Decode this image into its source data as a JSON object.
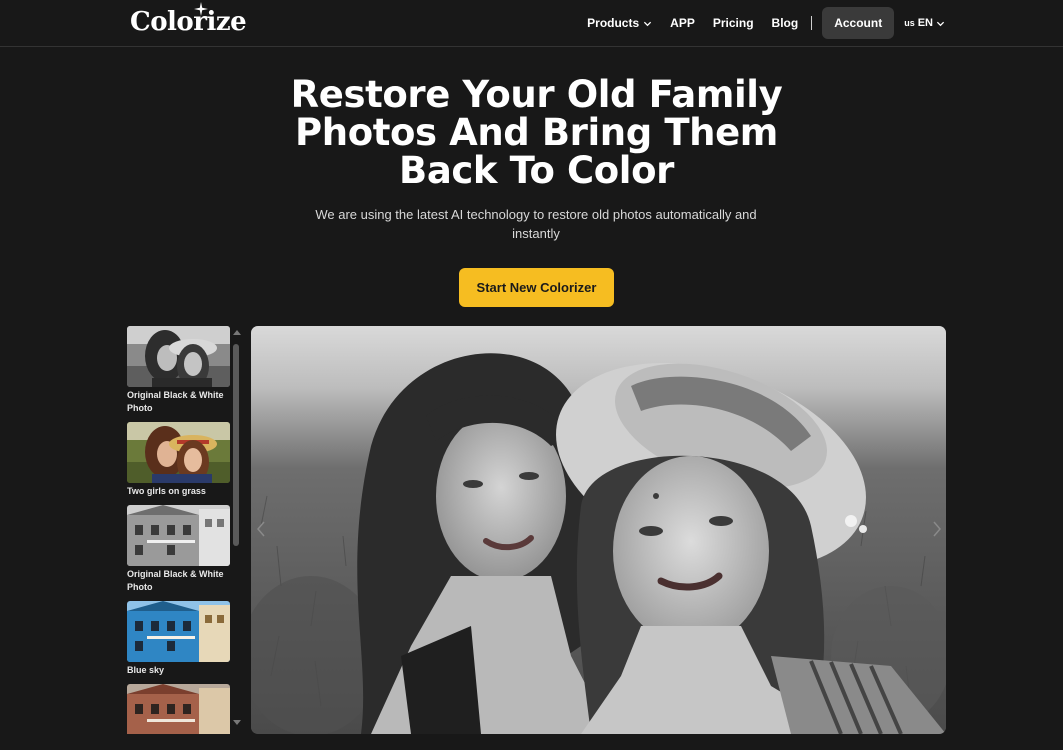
{
  "brand": {
    "name": "Colorize"
  },
  "nav": {
    "items": [
      {
        "label": "Products",
        "has_dropdown": true
      },
      {
        "label": "APP"
      },
      {
        "label": "Pricing"
      },
      {
        "label": "Blog"
      }
    ],
    "account_label": "Account",
    "lang": {
      "flag": "us",
      "code": "EN"
    }
  },
  "hero": {
    "title_lines": [
      "Restore Your Old Family",
      "Photos And Bring Them",
      "Back To Color"
    ],
    "subtitle": "We are using the latest AI technology to restore old photos automatically and instantly",
    "cta_label": "Start New Colorizer"
  },
  "samples": [
    {
      "caption": "Original Black & White Photo",
      "kind": "girls-bw"
    },
    {
      "caption": "Two girls on grass",
      "kind": "girls-color"
    },
    {
      "caption": "Original Black & White Photo",
      "kind": "house-bw"
    },
    {
      "caption": "Blue sky",
      "kind": "house-color"
    },
    {
      "caption": "",
      "kind": "house-warm"
    }
  ],
  "colors": {
    "background": "#181818",
    "accent": "#f6bd21",
    "account_bg": "#3a3a3a"
  },
  "icons": [
    "sparkle-icon",
    "chevron-down-icon",
    "scroll-up-icon",
    "scroll-down-icon",
    "chevron-left-icon",
    "chevron-right-icon"
  ]
}
